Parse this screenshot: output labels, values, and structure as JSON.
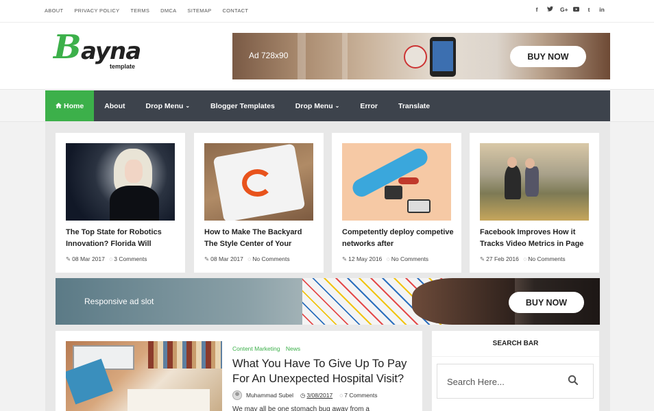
{
  "topbar": {
    "links": [
      "ABOUT",
      "PRIVACY POLICY",
      "TERMS",
      "DMCA",
      "SITEMAP",
      "CONTACT"
    ],
    "social": [
      {
        "icon": "facebook-icon",
        "glyph": "f"
      },
      {
        "icon": "twitter-icon",
        "glyph": "♥"
      },
      {
        "icon": "google-plus-icon",
        "glyph": "G+"
      },
      {
        "icon": "youtube-icon",
        "glyph": "▶"
      },
      {
        "icon": "tumblr-icon",
        "glyph": "t"
      },
      {
        "icon": "linkedin-icon",
        "glyph": "in"
      }
    ]
  },
  "logo": {
    "first": "B",
    "rest": "ayna",
    "sub": "template"
  },
  "header_ad": {
    "label": "Ad 728x90",
    "button": "BUY NOW"
  },
  "nav": {
    "items": [
      {
        "label": "Home",
        "icon": "home-icon",
        "active": true
      },
      {
        "label": "About"
      },
      {
        "label": "Drop Menu",
        "dropdown": true
      },
      {
        "label": "Blogger Templates"
      },
      {
        "label": "Drop Menu",
        "dropdown": true
      },
      {
        "label": "Error"
      },
      {
        "label": "Translate"
      }
    ]
  },
  "cards": [
    {
      "title": "The Top State for Robotics Innovation? Florida Will",
      "date": "08 Mar 2017",
      "comments": "3 Comments"
    },
    {
      "title": "How to Make The Backyard The Style Center of Your",
      "date": "08 Mar 2017",
      "comments": "No Comments"
    },
    {
      "title": "Competently deploy competive networks after",
      "date": "12 May 2016",
      "comments": "No Comments"
    },
    {
      "title": "Facebook Improves How it Tracks Video Metrics in Page",
      "date": "27 Feb 2016",
      "comments": "No Comments"
    }
  ],
  "mid_ad": {
    "label": "Responsive ad slot",
    "button": "BUY NOW"
  },
  "featured": {
    "tags": [
      "Content Marketing",
      "News"
    ],
    "title": "What You Have To Give Up To Pay For An Unexpected Hospital Visit?",
    "author": "Muhammad Subel",
    "date": "3/08/2017",
    "comments": "7 Comments",
    "excerpt": "We may all be one stomach bug away from a"
  },
  "sidebar": {
    "title": "SEARCH BAR",
    "search_placeholder": "Search Here..."
  },
  "colors": {
    "accent": "#3cb04a",
    "nav_bg": "#3d434c"
  }
}
